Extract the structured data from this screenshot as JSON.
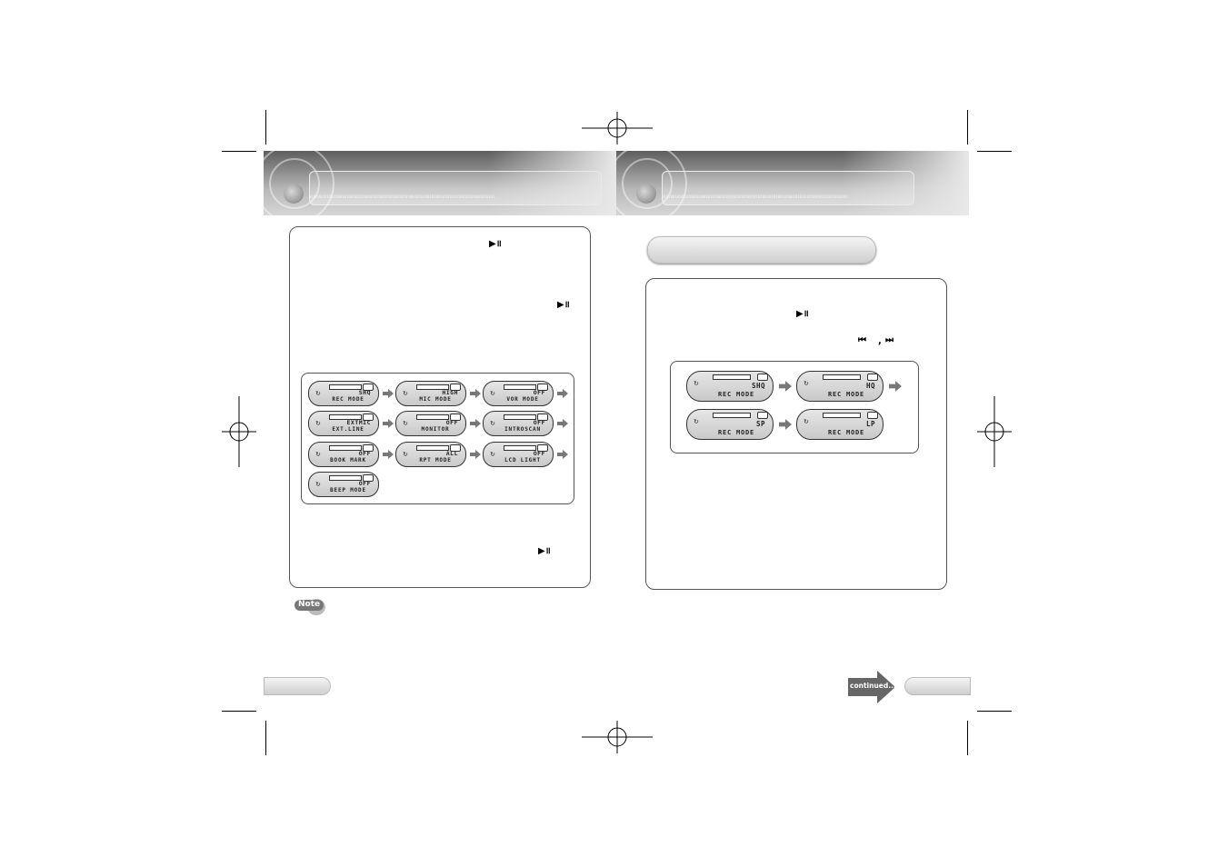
{
  "header_left": {
    "binary_strip": "0101001010101001010010101001010100101010010101001010100101001010101010010101001010101"
  },
  "header_right": {
    "binary_strip": "0101001010101001010010101001010100101010010101001010100101001010101010010101001010101"
  },
  "left_page": {
    "icons": {
      "play_pause_1": "play-pause",
      "play_pause_2": "play-pause",
      "play_pause_3": "play-pause"
    },
    "menu_modes": [
      {
        "top": "SHQ",
        "bottom": "REC MODE"
      },
      {
        "top": "HIGH",
        "bottom": "MIC MODE"
      },
      {
        "top": "OFF",
        "bottom": "VOR MODE"
      },
      {
        "top": "EXTMIC",
        "bottom": "EXT.LINE"
      },
      {
        "top": "OFF",
        "bottom": "MONITOR"
      },
      {
        "top": "OFF",
        "bottom": "INTROSCAN"
      },
      {
        "top": "OFF",
        "bottom": "BOOK MARK"
      },
      {
        "top": "ALL",
        "bottom": "RPT MODE"
      },
      {
        "top": "OFF",
        "bottom": "LCD LIGHT"
      },
      {
        "top": "OFF",
        "bottom": "BEEP MODE"
      }
    ],
    "note_label": "Note",
    "lcd_symbol": "↻"
  },
  "right_page": {
    "rec_modes": [
      {
        "top": "SHQ",
        "bottom": "REC MODE"
      },
      {
        "top": "HQ",
        "bottom": "REC MODE"
      },
      {
        "top": "SP",
        "bottom": "REC MODE"
      },
      {
        "top": "LP",
        "bottom": "REC MODE"
      }
    ],
    "skip_separator": ",",
    "continued_label": "continued..."
  }
}
